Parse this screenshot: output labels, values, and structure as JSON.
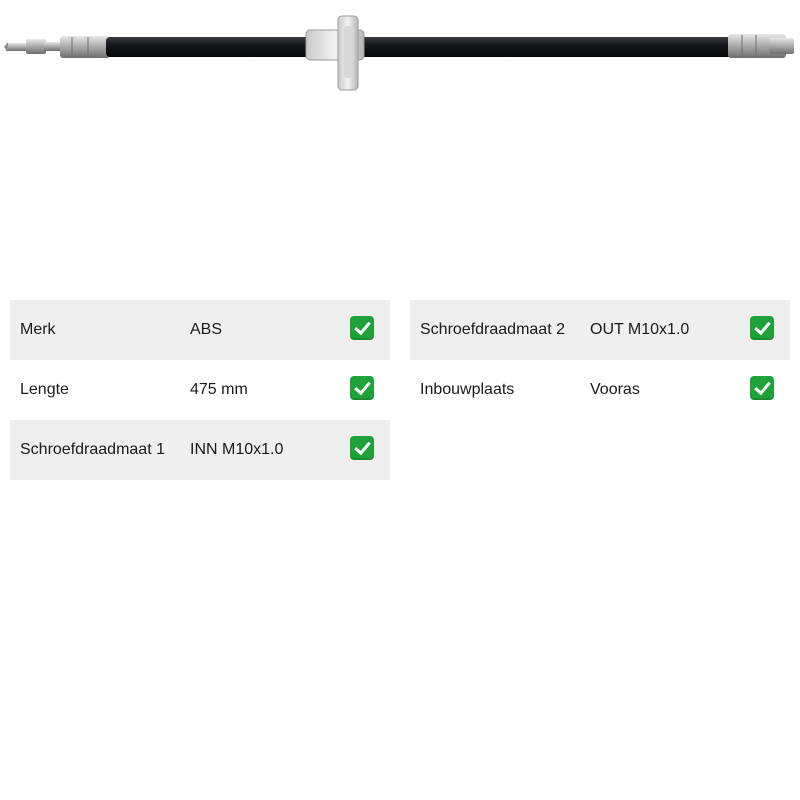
{
  "product": {
    "image_icon": "brake-hose-icon"
  },
  "specs_left": [
    {
      "label": "Merk",
      "value": "ABS",
      "check_icon": "check-icon"
    },
    {
      "label": "Lengte",
      "value": "475 mm",
      "check_icon": "check-icon"
    },
    {
      "label": "Schroefdraadmaat 1",
      "value": "INN M10x1.0",
      "check_icon": "check-icon"
    }
  ],
  "specs_right": [
    {
      "label": "Schroefdraadmaat 2",
      "value": "OUT M10x1.0",
      "check_icon": "check-icon"
    },
    {
      "label": "Inbouwplaats",
      "value": "Vooras",
      "check_icon": "check-icon"
    }
  ],
  "colors": {
    "row_shade": "#efefef",
    "check_green": "#1fa23a"
  }
}
